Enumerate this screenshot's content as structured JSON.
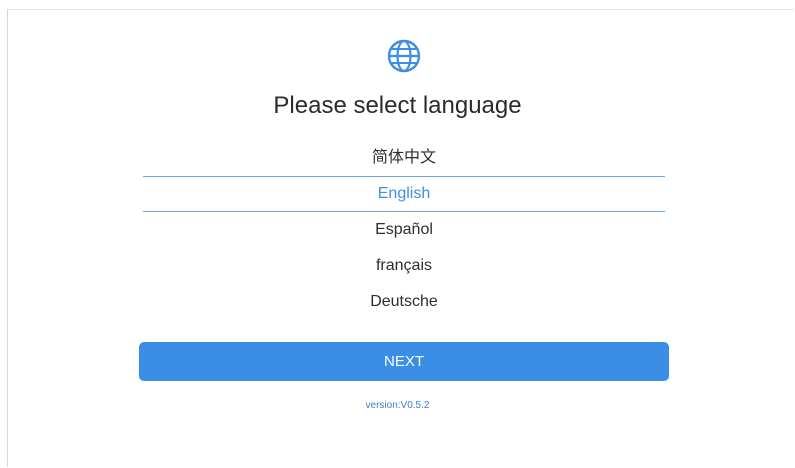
{
  "page": {
    "title": "Please select language",
    "globe_icon": "globe-icon"
  },
  "languages": [
    {
      "label": "简体中文",
      "selected": false
    },
    {
      "label": "English",
      "selected": true
    },
    {
      "label": "Español",
      "selected": false
    },
    {
      "label": "français",
      "selected": false
    },
    {
      "label": "Deutsche",
      "selected": false
    }
  ],
  "actions": {
    "next_label": "NEXT"
  },
  "footer": {
    "version": "version:V0.5.2"
  },
  "colors": {
    "accent": "#3a8ee6",
    "selected_text": "#3d8fe0",
    "divider": "#6aa6e6"
  }
}
